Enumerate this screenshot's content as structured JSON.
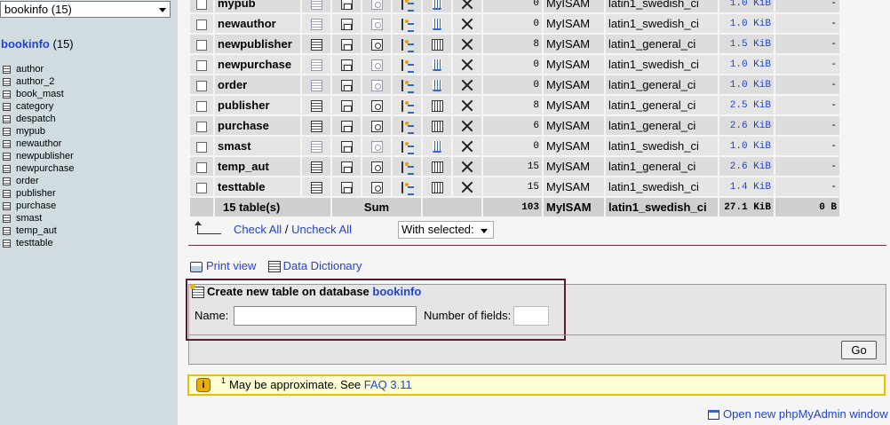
{
  "nav": {
    "db_select_value": "bookinfo (15)",
    "db_name": "bookinfo",
    "db_count": "(15)",
    "tables": [
      "author",
      "author_2",
      "book_mast",
      "category",
      "despatch",
      "mypub",
      "newauthor",
      "newpublisher",
      "newpurchase",
      "order",
      "publisher",
      "purchase",
      "smast",
      "temp_aut",
      "testtable"
    ]
  },
  "table_rows": [
    {
      "name": "mypub",
      "rows": "0",
      "engine": "MyISAM",
      "collation": "latin1_swedish_ci",
      "size": "1.0 KiB",
      "overhead": "-",
      "empty": true
    },
    {
      "name": "newauthor",
      "rows": "0",
      "engine": "MyISAM",
      "collation": "latin1_swedish_ci",
      "size": "1.0 KiB",
      "overhead": "-",
      "empty": true
    },
    {
      "name": "newpublisher",
      "rows": "8",
      "engine": "MyISAM",
      "collation": "latin1_general_ci",
      "size": "1.5 KiB",
      "overhead": "-",
      "empty": false
    },
    {
      "name": "newpurchase",
      "rows": "0",
      "engine": "MyISAM",
      "collation": "latin1_swedish_ci",
      "size": "1.0 KiB",
      "overhead": "-",
      "empty": true
    },
    {
      "name": "order",
      "rows": "0",
      "engine": "MyISAM",
      "collation": "latin1_general_ci",
      "size": "1.0 KiB",
      "overhead": "-",
      "empty": true
    },
    {
      "name": "publisher",
      "rows": "8",
      "engine": "MyISAM",
      "collation": "latin1_general_ci",
      "size": "2.5 KiB",
      "overhead": "-",
      "empty": false
    },
    {
      "name": "purchase",
      "rows": "6",
      "engine": "MyISAM",
      "collation": "latin1_general_ci",
      "size": "2.6 KiB",
      "overhead": "-",
      "empty": false
    },
    {
      "name": "smast",
      "rows": "0",
      "engine": "MyISAM",
      "collation": "latin1_swedish_ci",
      "size": "1.0 KiB",
      "overhead": "-",
      "empty": true
    },
    {
      "name": "temp_aut",
      "rows": "15",
      "engine": "MyISAM",
      "collation": "latin1_general_ci",
      "size": "2.6 KiB",
      "overhead": "-",
      "empty": false
    },
    {
      "name": "testtable",
      "rows": "15",
      "engine": "MyISAM",
      "collation": "latin1_swedish_ci",
      "size": "1.4 KiB",
      "overhead": "-",
      "empty": false
    }
  ],
  "summary": {
    "tables": "15 table(s)",
    "label": "Sum",
    "rows": "103",
    "engine": "MyISAM",
    "collation": "latin1_swedish_ci",
    "size": "27.1 KiB",
    "overhead": "0 B"
  },
  "actions": {
    "check_all": "Check All",
    "separator": "/",
    "uncheck_all": "Uncheck All",
    "with_selected_label": "With selected:",
    "with_selected_value": ""
  },
  "links": {
    "print_view": "Print view",
    "data_dictionary": "Data Dictionary",
    "open_new_window": "Open new phpMyAdmin window"
  },
  "create_table": {
    "legend": "Create new table on database",
    "db_link": "bookinfo",
    "name_label": "Name:",
    "name_value": "",
    "fields_label": "Number of fields:",
    "fields_value": "",
    "go_label": "Go"
  },
  "notice": {
    "sup": "1",
    "text": "May be approximate. See",
    "faq_link": "FAQ 3.11",
    "icon": "i"
  },
  "colors": {
    "nav_bg": "#d0dce0",
    "link": "#2244cc",
    "highlight_border": "#5a1a33",
    "notice_border": "#e8c000"
  }
}
